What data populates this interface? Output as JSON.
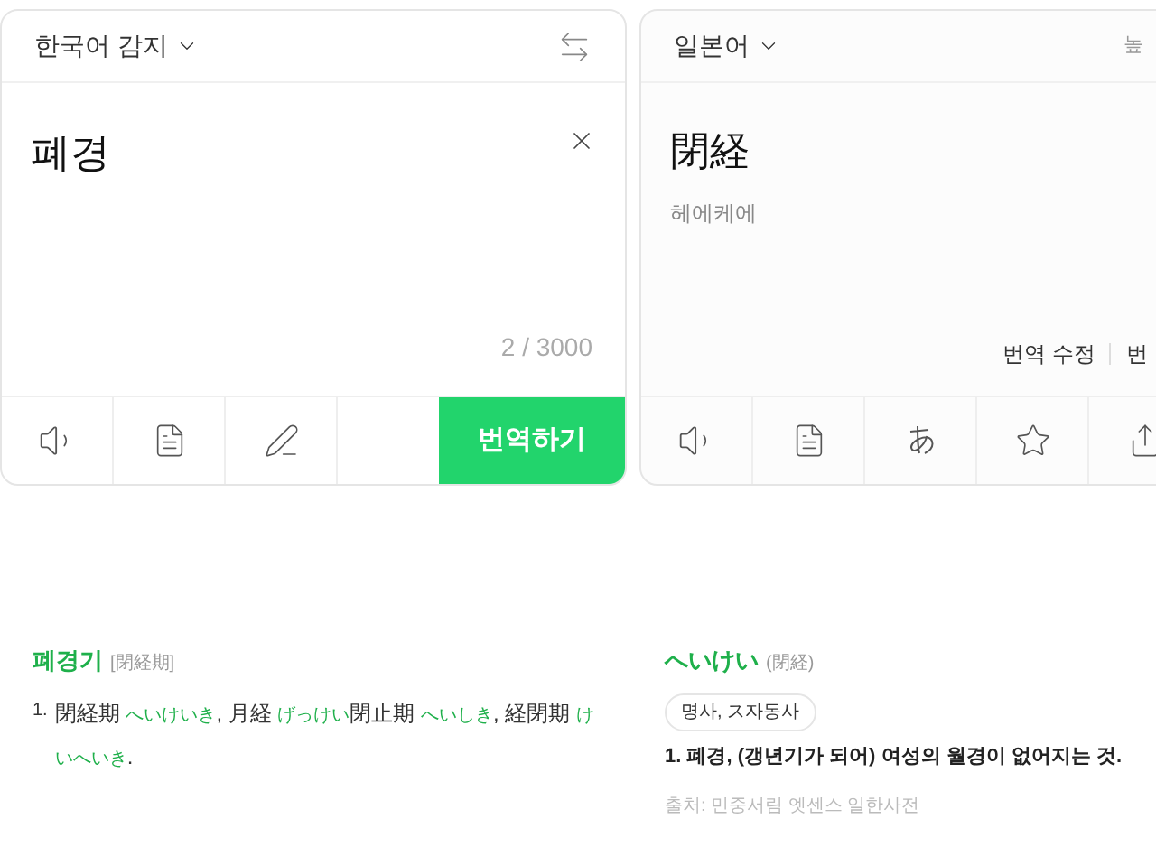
{
  "source": {
    "language": "한국어 감지",
    "text": "폐경",
    "counter": "2 / 3000",
    "translate_button": "번역하기"
  },
  "target": {
    "language": "일본어",
    "header_cut": "높",
    "text": "閉経",
    "pronunciation": "헤에케에",
    "edit_link": "번역 수정",
    "cut_link": "번"
  },
  "dict_left": {
    "headword": "폐경기",
    "hanja": "[閉経期]",
    "number": "1.",
    "segments": [
      {
        "kind": "text",
        "text": "閉経期 "
      },
      {
        "kind": "reading",
        "text": "へいけいき"
      },
      {
        "kind": "text",
        "text": ", 月経 "
      },
      {
        "kind": "reading",
        "text": "げっけい"
      },
      {
        "kind": "text",
        "text": "閉止期 "
      },
      {
        "kind": "reading",
        "text": "へいしき"
      },
      {
        "kind": "text",
        "text": ", 経閉期 "
      },
      {
        "kind": "reading",
        "text": "けいへいき"
      },
      {
        "kind": "text",
        "text": "."
      }
    ]
  },
  "dict_right": {
    "headword": "へいけい",
    "hanja": "(閉経)",
    "pos": "명사, ス자동사",
    "meaning": "1. 폐경, (갱년기가 되어) 여성의 월경이 없어지는 것.",
    "source": "출처: 민중서림 엣센스 일한사전"
  }
}
